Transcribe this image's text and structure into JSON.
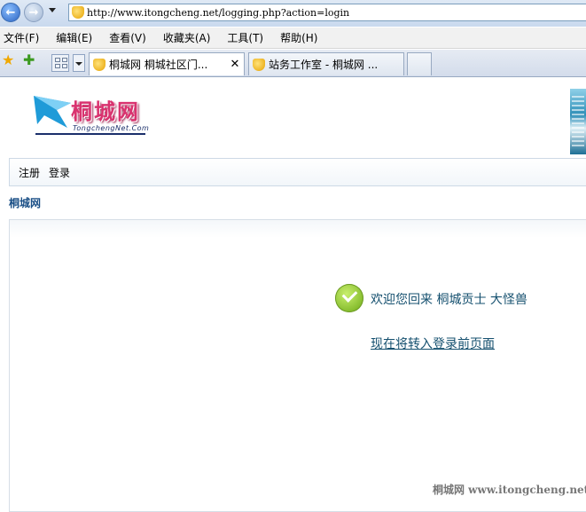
{
  "browser": {
    "address": "http://www.itongcheng.net/logging.php?action=login",
    "menu": [
      "文件(F)",
      "编辑(E)",
      "查看(V)",
      "收藏夹(A)",
      "工具(T)",
      "帮助(H)"
    ],
    "tabs": [
      {
        "label": "桐城网 桐城社区门...",
        "active": true,
        "close": "✕"
      },
      {
        "label": "站务工作室 - 桐城网 ...",
        "active": false
      }
    ]
  },
  "logo": {
    "text": "桐城网",
    "subtext": "TongchengNet.Com"
  },
  "topnav": {
    "register": "注册",
    "login": "登录"
  },
  "breadcrumb": "桐城网",
  "message": {
    "welcome": "欢迎您回来 桐城贡士 大怪兽",
    "redirect": "现在将转入登录前页面"
  },
  "watermark": "桐城网 www.itongcheng.net",
  "colors": {
    "link": "#15506f",
    "breadcrumb": "#1a4f86",
    "logo": "#d9336f",
    "success": "#6aa814"
  }
}
